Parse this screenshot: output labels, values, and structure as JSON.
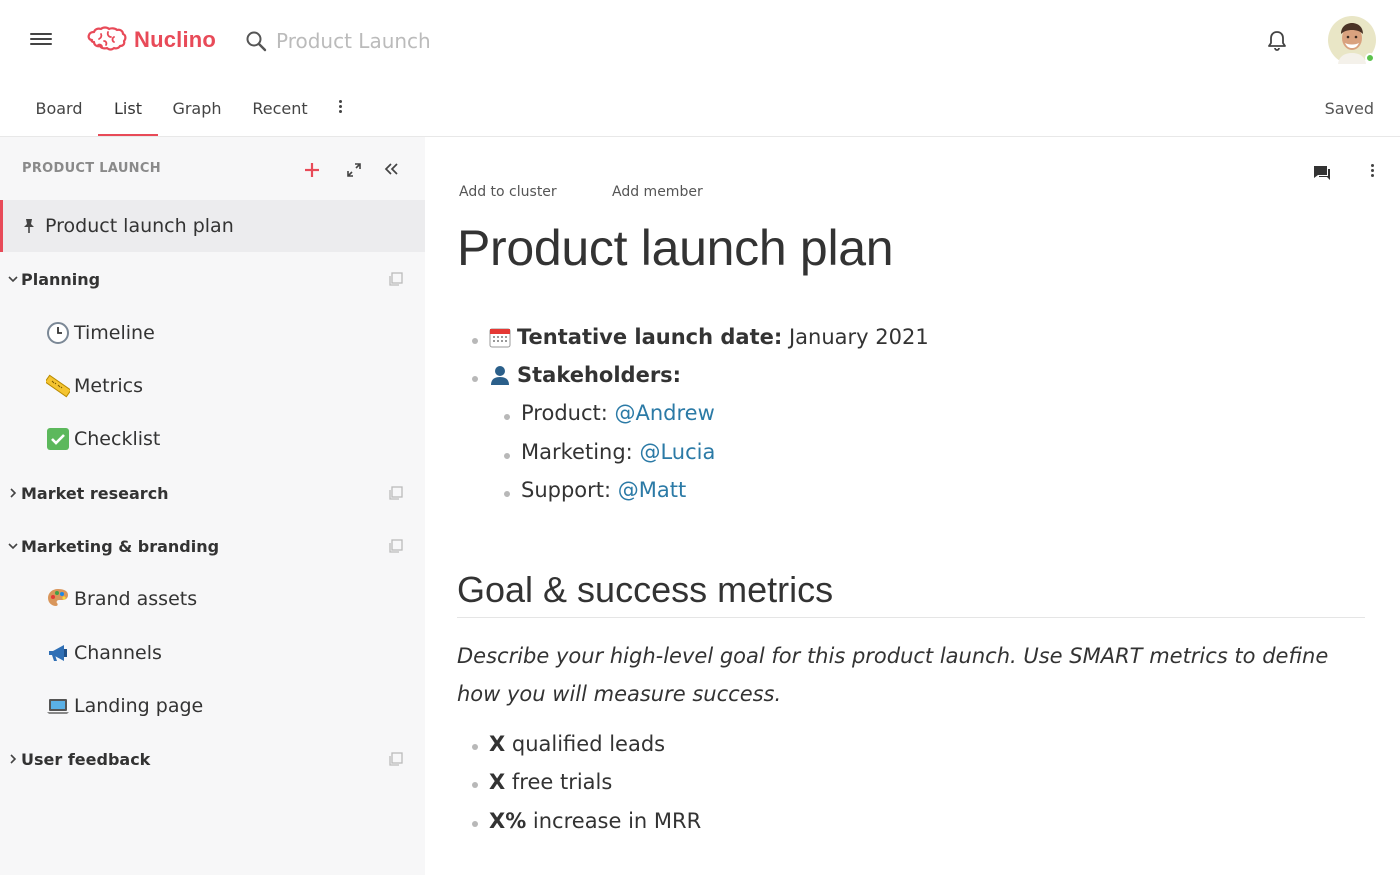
{
  "app": {
    "name": "Nuclino",
    "brand_color": "#e84a58"
  },
  "search": {
    "placeholder": "Product Launch"
  },
  "tabs": [
    {
      "label": "Board"
    },
    {
      "label": "List",
      "active": true
    },
    {
      "label": "Graph"
    },
    {
      "label": "Recent"
    }
  ],
  "status": {
    "saved": "Saved"
  },
  "sidebar": {
    "title": "PRODUCT LAUNCH",
    "items": [
      {
        "label": "Product launch plan",
        "icon": "pin-icon",
        "pinned": true
      },
      {
        "label": "Planning",
        "type": "cluster",
        "expanded": true
      },
      {
        "label": "Timeline",
        "icon": "clock-icon"
      },
      {
        "label": "Metrics",
        "icon": "ruler-icon"
      },
      {
        "label": "Checklist",
        "icon": "check-mark-icon"
      },
      {
        "label": "Market research",
        "type": "cluster",
        "expanded": false
      },
      {
        "label": "Marketing & branding",
        "type": "cluster",
        "expanded": true
      },
      {
        "label": "Brand assets",
        "icon": "palette-icon"
      },
      {
        "label": "Channels",
        "icon": "megaphone-icon"
      },
      {
        "label": "Landing page",
        "icon": "laptop-icon"
      },
      {
        "label": "User feedback",
        "type": "cluster",
        "expanded": false
      }
    ]
  },
  "doc": {
    "add_to_cluster": "Add to cluster",
    "add_member": "Add member",
    "title": "Product launch plan",
    "launch": {
      "label": "Tentative launch date:",
      "value": "January 2021"
    },
    "stakeholders": {
      "label": "Stakeholders:",
      "items": [
        {
          "role": "Product:",
          "mention": "@Andrew"
        },
        {
          "role": "Marketing:",
          "mention": "@Lucia"
        },
        {
          "role": "Support:",
          "mention": "@Matt"
        }
      ]
    },
    "section": {
      "heading": "Goal & success metrics",
      "description": "Describe your high-level goal for this product launch. Use SMART metrics to define how you will measure success.",
      "bullets": [
        {
          "bold": "X",
          "rest": " qualified leads"
        },
        {
          "bold": "X",
          "rest": " free trials"
        },
        {
          "bold": "X%",
          "rest": " increase in MRR"
        }
      ]
    }
  }
}
